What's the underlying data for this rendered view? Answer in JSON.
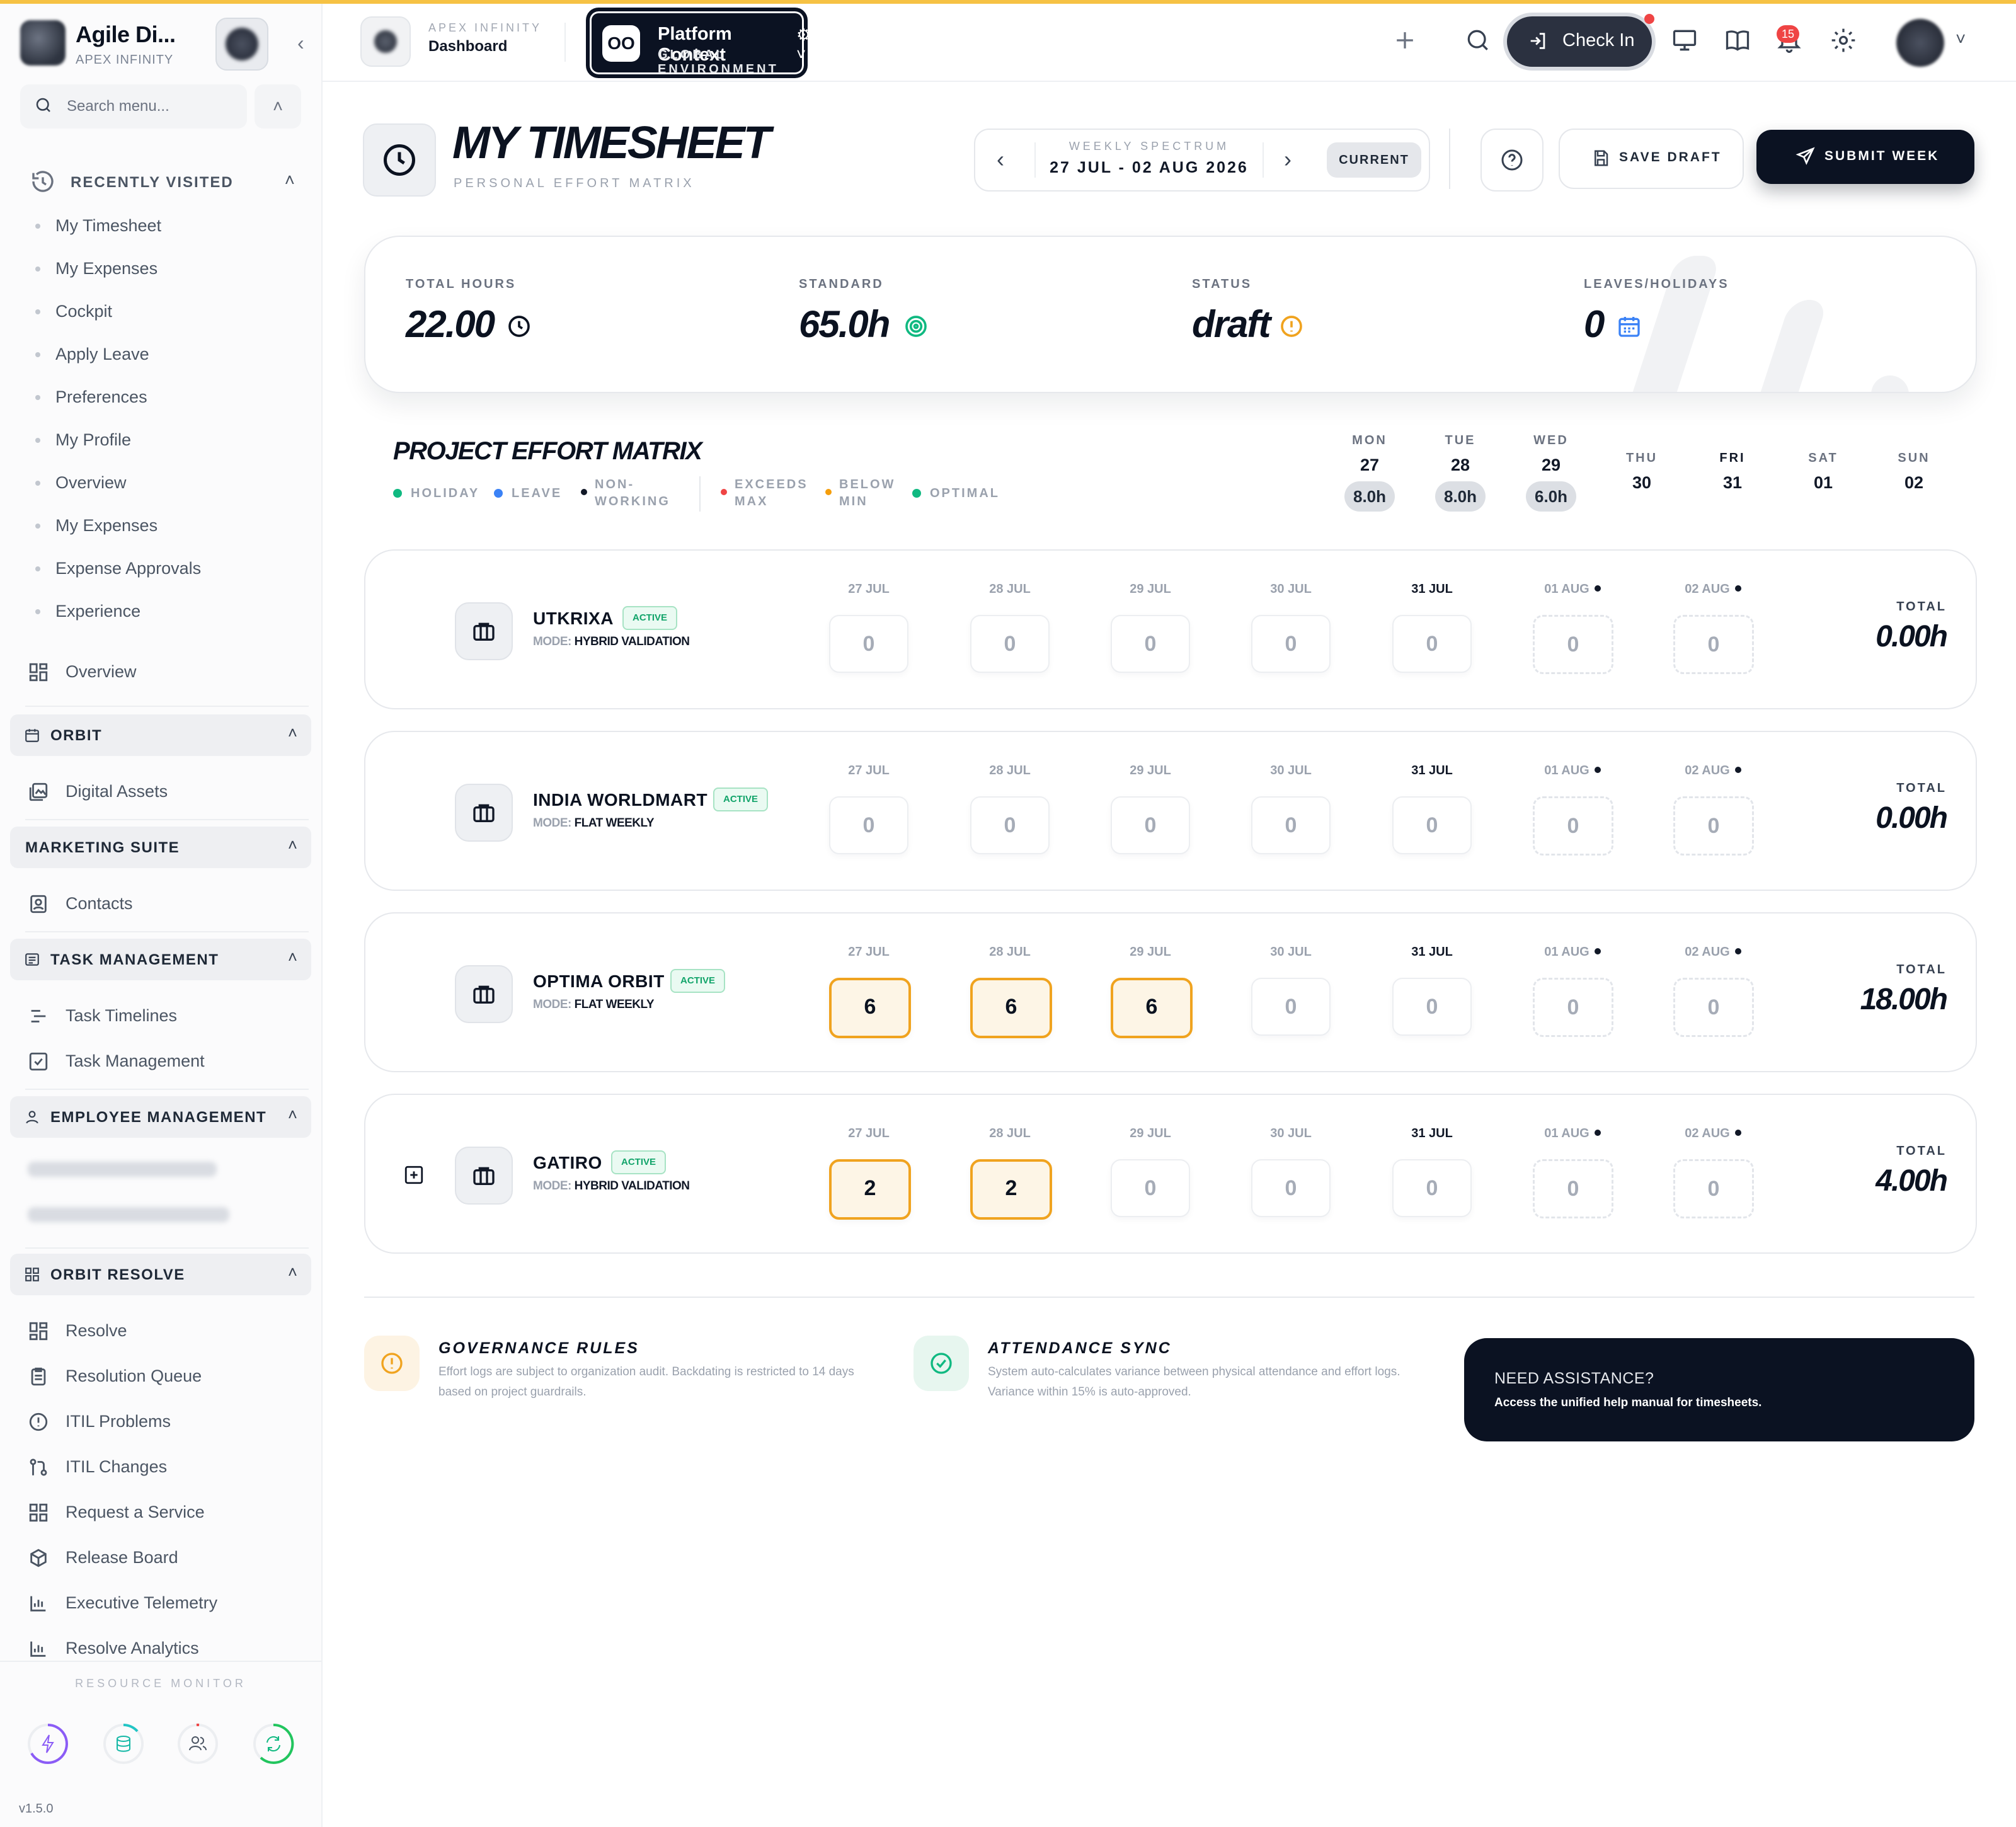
{
  "app": {
    "name": "Agile Di...",
    "org": "APEX INFINITY",
    "version": "v1.5.0",
    "accent_color": "#f6c244"
  },
  "sidebar": {
    "search_placeholder": "Search menu...",
    "recently_visited": {
      "label": "RECENTLY VISITED",
      "items": [
        "My Timesheet",
        "My Expenses",
        "Cockpit",
        "Apply Leave",
        "Preferences",
        "My Profile",
        "Overview",
        "My Expenses",
        "Expense Approvals",
        "Experience"
      ]
    },
    "overview_label": "Overview",
    "sections": {
      "orbit": {
        "label": "ORBIT",
        "items": [
          "Digital Assets"
        ]
      },
      "marketing": {
        "label": "MARKETING SUITE",
        "items": [
          "Contacts"
        ]
      },
      "task": {
        "label": "TASK MANAGEMENT",
        "items": [
          "Task Timelines",
          "Task Management"
        ]
      },
      "employee": {
        "label": "EMPLOYEE MANAGEMENT"
      },
      "resolve": {
        "label": "ORBIT RESOLVE",
        "items": [
          "Resolve",
          "Resolution Queue",
          "ITIL Problems",
          "ITIL Changes",
          "Request a Service",
          "Release Board",
          "Executive Telemetry",
          "Resolve Analytics"
        ]
      }
    },
    "resource_monitor_label": "RESOURCE MONITOR",
    "resource_monitor_icons": [
      "bolt-icon",
      "database-icon",
      "users-icon",
      "refresh-icon"
    ]
  },
  "topbar": {
    "crumb_org": "APEX INFINITY",
    "crumb_page": "Dashboard",
    "context_badge": "OO",
    "context_title": "Platform Context",
    "context_sub": "GLOBAL ENVIRONMENT",
    "checkin_label": "Check In",
    "notification_count": "15"
  },
  "page": {
    "title": "MY TIMESHEET",
    "subtitle": "PERSONAL EFFORT MATRIX",
    "week_label": "WEEKLY SPECTRUM",
    "week_range": "27 JUL - 02 AUG 2026",
    "current_label": "CURRENT",
    "save_label": "SAVE DRAFT",
    "submit_label": "SUBMIT WEEK"
  },
  "stats": [
    {
      "label": "TOTAL HOURS",
      "value": "22.00",
      "icon": "clock-icon"
    },
    {
      "label": "STANDARD",
      "value": "65.0h",
      "icon": "target-icon"
    },
    {
      "label": "STATUS",
      "value": "draft",
      "icon": "alert-circle-icon"
    },
    {
      "label": "LEAVES/HOLIDAYS",
      "value": "0",
      "icon": "calendar-icon"
    }
  ],
  "matrix": {
    "title": "PROJECT EFFORT MATRIX",
    "legend": [
      {
        "label": "HOLIDAY",
        "color": "#10b981"
      },
      {
        "label": "LEAVE",
        "color": "#3b82f6"
      },
      {
        "label1": "NON-",
        "label2": "WORKING",
        "color": "#111827"
      },
      {
        "label1": "EXCEEDS",
        "label2": "MAX",
        "color": "#ef4444"
      },
      {
        "label1": "BELOW",
        "label2": "MIN",
        "color": "#f59e0b"
      },
      {
        "label": "OPTIMAL",
        "color": "#10b981"
      }
    ],
    "days": [
      {
        "name": "MON",
        "date": "27",
        "hours": "8.0h"
      },
      {
        "name": "TUE",
        "date": "28",
        "hours": "8.0h"
      },
      {
        "name": "WED",
        "date": "29",
        "hours": "6.0h"
      },
      {
        "name": "THU",
        "date": "30",
        "hours": ""
      },
      {
        "name": "FRI",
        "date": "31",
        "hours": ""
      },
      {
        "name": "SAT",
        "date": "01",
        "hours": ""
      },
      {
        "name": "SUN",
        "date": "02",
        "hours": ""
      }
    ],
    "cell_dates": [
      "27 JUL",
      "28 JUL",
      "29 JUL",
      "30 JUL",
      "31 JUL",
      "01 AUG",
      "02 AUG"
    ],
    "total_label": "TOTAL",
    "projects": [
      {
        "name": "UTKRIXA",
        "status": "ACTIVE",
        "mode_label": "MODE:",
        "mode": "HYBRID VALIDATION",
        "hours": [
          "0",
          "0",
          "0",
          "0",
          "0",
          "0",
          "0"
        ],
        "total": "0.00h"
      },
      {
        "name": "INDIA WORLDMART",
        "status": "ACTIVE",
        "mode_label": "MODE:",
        "mode": "FLAT WEEKLY",
        "hours": [
          "0",
          "0",
          "0",
          "0",
          "0",
          "0",
          "0"
        ],
        "total": "0.00h"
      },
      {
        "name": "OPTIMA ORBIT",
        "status": "ACTIVE",
        "mode_label": "MODE:",
        "mode": "FLAT WEEKLY",
        "hours": [
          "6",
          "6",
          "6",
          "0",
          "0",
          "0",
          "0"
        ],
        "total": "18.00h"
      },
      {
        "name": "GATIRO",
        "status": "ACTIVE",
        "mode_label": "MODE:",
        "mode": "HYBRID VALIDATION",
        "hours": [
          "2",
          "2",
          "0",
          "0",
          "0",
          "0",
          "0"
        ],
        "total": "4.00h"
      }
    ]
  },
  "footer": {
    "governance_title": "GOVERNANCE RULES",
    "governance_text": "Effort logs are subject to organization audit. Backdating is restricted to 14 days based on project guardrails.",
    "attendance_title": "ATTENDANCE SYNC",
    "attendance_text": "System auto-calculates variance between physical attendance and effort logs. Variance within 15% is auto-approved.",
    "assist_title": "NEED ASSISTANCE?",
    "assist_text": "Access the unified help manual for timesheets."
  }
}
